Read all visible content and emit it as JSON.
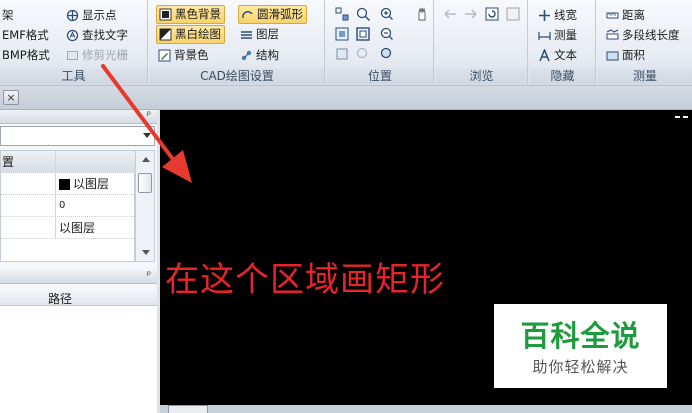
{
  "ribbon": {
    "groups": {
      "tools": {
        "label": "工具",
        "items": [
          "架",
          "EMF格式",
          "BMP格式",
          "显示点",
          "查找文字",
          "修剪光栅"
        ]
      },
      "cad_settings": {
        "label": "CAD绘图设置",
        "items": [
          "黑色背景",
          "黑白绘图",
          "背景色",
          "圆滑弧形",
          "图层",
          "结构"
        ]
      },
      "position": {
        "label": "位置"
      },
      "browse": {
        "label": "浏览"
      },
      "hide": {
        "label": "隐藏",
        "items": [
          "线宽",
          "测量",
          "文本"
        ]
      },
      "measure": {
        "label": "测量",
        "items": [
          "距离",
          "多段线长度",
          "面积"
        ]
      }
    }
  },
  "tabstrip": {
    "close_glyph": "×"
  },
  "left_panel": {
    "pin_glyph": "ᵖ",
    "properties": {
      "rows": [
        {
          "label": "置",
          "value": ""
        },
        {
          "label": "",
          "value": "以图层"
        },
        {
          "label": "",
          "value": "0"
        },
        {
          "label": "",
          "value": "以图层"
        }
      ]
    },
    "file_list": {
      "column_header": "路径"
    }
  },
  "canvas": {
    "annotation_text": "在这个区域画矩形",
    "text_color": "#e5252a",
    "background": "#000000"
  },
  "watermark": {
    "title": "百科全说",
    "subtitle": "助你轻松解决"
  },
  "colors": {
    "arrow": "#e63a2e",
    "accent_green": "#1e9b3d",
    "active_button": "#f8d36b"
  }
}
